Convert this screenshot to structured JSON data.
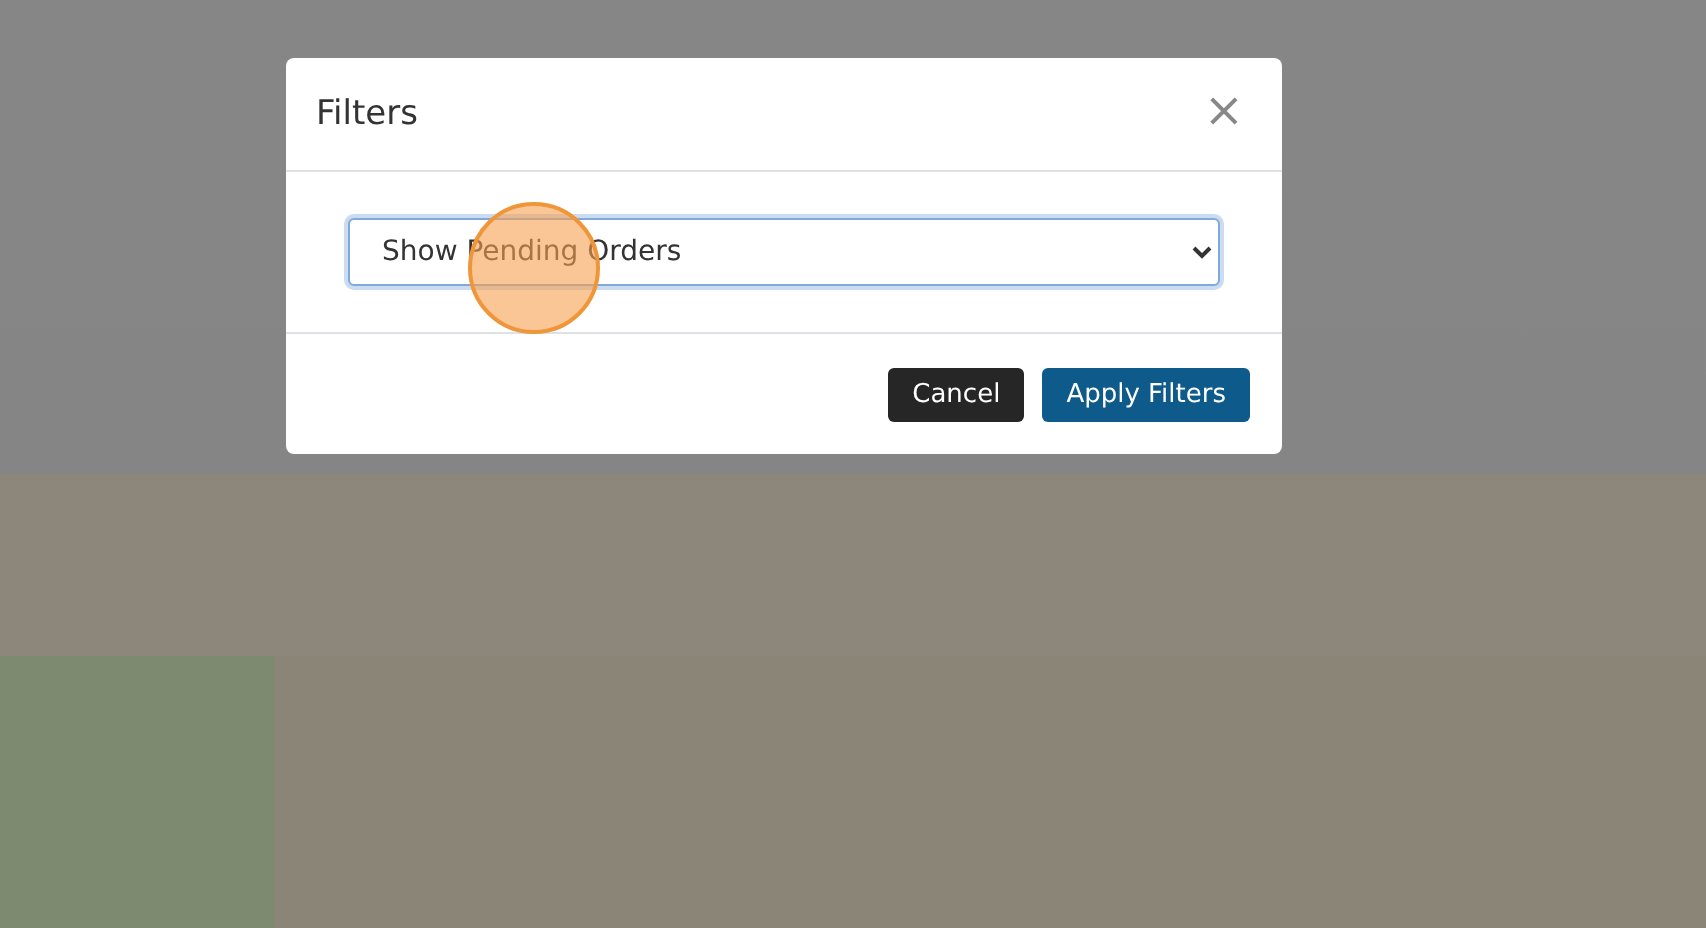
{
  "dialog": {
    "title": "Filters",
    "close": "×",
    "filter": {
      "value": "Show Pending Orders"
    },
    "buttons": [
      {
        "label": "Cancel",
        "kind": "secondary"
      },
      {
        "label": "Apply Filters",
        "kind": "primary"
      }
    ]
  }
}
